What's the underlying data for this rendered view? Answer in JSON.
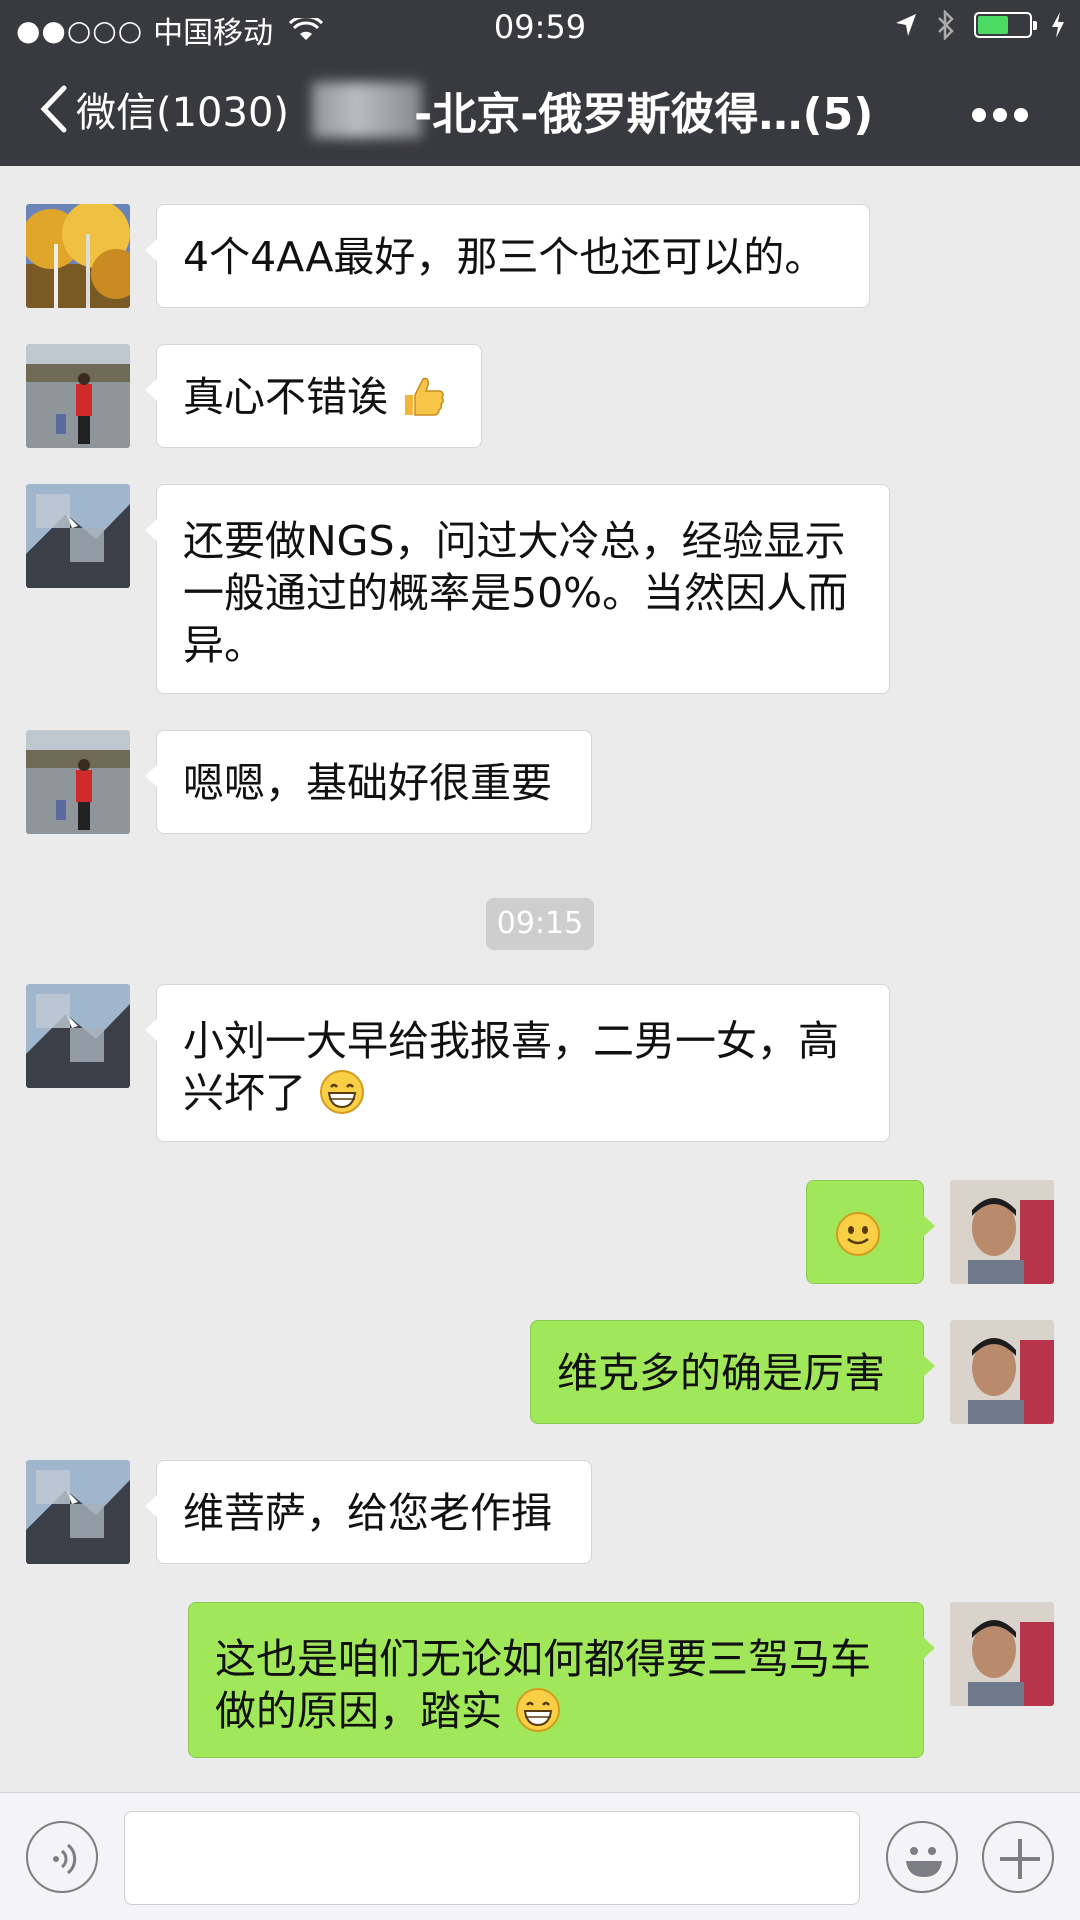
{
  "status_bar": {
    "signal": "●●○○○",
    "carrier": "中国移动",
    "time": "09:59"
  },
  "nav": {
    "back_label": "微信(1030)",
    "title": "-北京-俄罗斯彼得…(5)"
  },
  "messages": [
    {
      "dir": "in",
      "text": "4个4AA最好，那三个也还可以的。",
      "avatar": "autumn-trees-avatar"
    },
    {
      "dir": "in",
      "text": "真心不错诶",
      "emoji": "thumbs-up",
      "avatar": "lake-family-avatar"
    },
    {
      "dir": "in",
      "text": "还要做NGS，问过大冷总，经验显示一般通过的概率是50%。当然因人而异。",
      "avatar": "mountain-avatar"
    },
    {
      "dir": "in",
      "text": "嗯嗯，基础好很重要",
      "avatar": "lake-family-avatar"
    },
    {
      "dir": "in",
      "text": "小刘一大早给我报喜，二男一女，高兴坏了",
      "emoji": "grin",
      "avatar": "mountain-avatar"
    },
    {
      "dir": "out",
      "text": "",
      "emoji": "smile",
      "avatar": "train-selfie-avatar"
    },
    {
      "dir": "out",
      "text": "维克多的确是厉害",
      "avatar": "train-selfie-avatar"
    },
    {
      "dir": "in",
      "text": "维菩萨，给您老作揖",
      "avatar": "mountain-avatar"
    },
    {
      "dir": "out",
      "text": "这也是咱们无论如何都得要三驾马车做的原因，踏实",
      "emoji": "grin",
      "avatar": "train-selfie-avatar"
    }
  ],
  "timestamp_divider": "09:15",
  "colors": {
    "nav_bg": "#393a3f",
    "chat_bg": "#ebebeb",
    "out_bubble": "#a0e75a",
    "in_bubble": "#ffffff",
    "battery": "#4cd964"
  },
  "icons": {
    "back": "chevron-left-icon",
    "more": "more-dots-icon",
    "voice": "voice-icon",
    "emoji": "emoji-icon",
    "plus": "plus-icon"
  }
}
